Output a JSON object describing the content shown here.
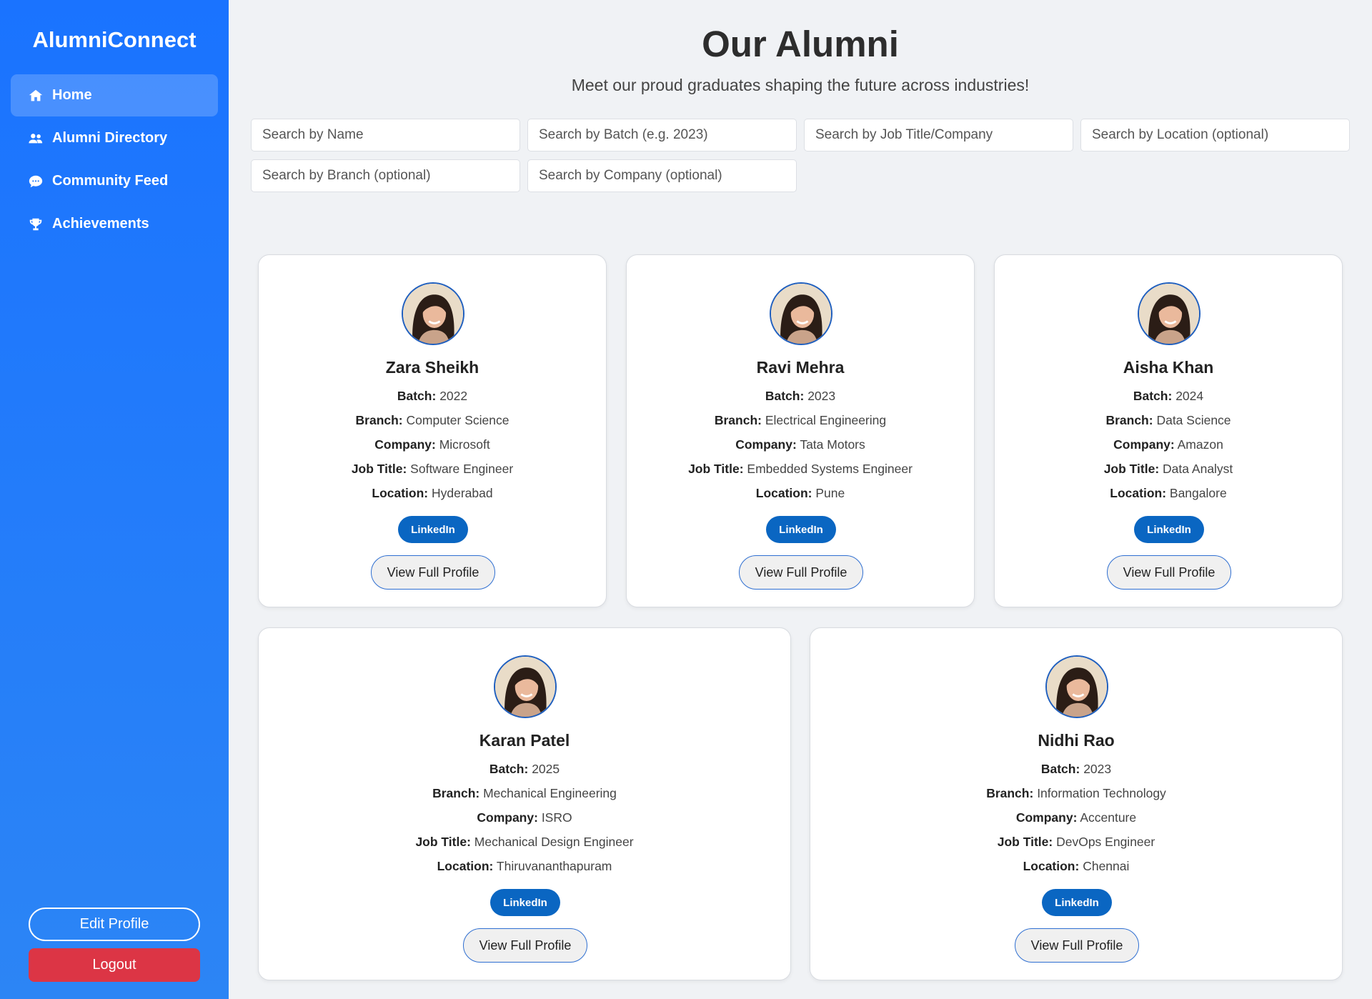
{
  "app": {
    "brand": "AlumniConnect"
  },
  "sidebar": {
    "items": [
      {
        "label": "Home",
        "icon": "home-icon"
      },
      {
        "label": "Alumni Directory",
        "icon": "users-icon"
      },
      {
        "label": "Community Feed",
        "icon": "chat-bubble-icon"
      },
      {
        "label": "Achievements",
        "icon": "trophy-icon"
      }
    ],
    "edit_profile": "Edit Profile",
    "logout": "Logout"
  },
  "header": {
    "title": "Our Alumni",
    "subtitle": "Meet our proud graduates shaping the future across industries!"
  },
  "search": {
    "name": "Search by Name",
    "batch": "Search by Batch (e.g. 2023)",
    "job": "Search by Job Title/Company",
    "location": "Search by Location (optional)",
    "branch": "Search by Branch (optional)",
    "company": "Search by Company (optional)"
  },
  "labels": {
    "batch": "Batch:",
    "branch": "Branch:",
    "company": "Company:",
    "job_title": "Job Title:",
    "location": "Location:",
    "linkedin": "LinkedIn",
    "view_profile": "View Full Profile"
  },
  "alumni": [
    {
      "name": "Zara Sheikh",
      "batch": "2022",
      "branch": "Computer Science",
      "company": "Microsoft",
      "job_title": "Software Engineer",
      "location": "Hyderabad"
    },
    {
      "name": "Ravi Mehra",
      "batch": "2023",
      "branch": "Electrical Engineering",
      "company": "Tata Motors",
      "job_title": "Embedded Systems Engineer",
      "location": "Pune"
    },
    {
      "name": "Aisha Khan",
      "batch": "2024",
      "branch": "Data Science",
      "company": "Amazon",
      "job_title": "Data Analyst",
      "location": "Bangalore"
    },
    {
      "name": "Karan Patel",
      "batch": "2025",
      "branch": "Mechanical Engineering",
      "company": "ISRO",
      "job_title": "Mechanical Design Engineer",
      "location": "Thiruvananthapuram"
    },
    {
      "name": "Nidhi Rao",
      "batch": "2023",
      "branch": "Information Technology",
      "company": "Accenture",
      "job_title": "DevOps Engineer",
      "location": "Chennai"
    }
  ],
  "colors": {
    "sidebar": "#1a73ff",
    "linkedin": "#0a66c2",
    "logout": "#dc3545",
    "page_bg": "#f0f2f5"
  }
}
